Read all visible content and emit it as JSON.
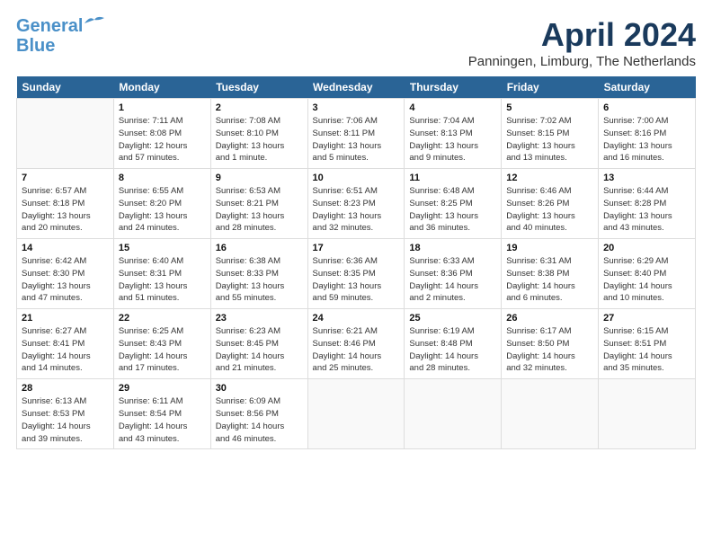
{
  "header": {
    "logo_line1": "General",
    "logo_line2": "Blue",
    "month_title": "April 2024",
    "location": "Panningen, Limburg, The Netherlands"
  },
  "days_of_week": [
    "Sunday",
    "Monday",
    "Tuesday",
    "Wednesday",
    "Thursday",
    "Friday",
    "Saturday"
  ],
  "weeks": [
    [
      {
        "day": "",
        "info": ""
      },
      {
        "day": "1",
        "info": "Sunrise: 7:11 AM\nSunset: 8:08 PM\nDaylight: 12 hours\nand 57 minutes."
      },
      {
        "day": "2",
        "info": "Sunrise: 7:08 AM\nSunset: 8:10 PM\nDaylight: 13 hours\nand 1 minute."
      },
      {
        "day": "3",
        "info": "Sunrise: 7:06 AM\nSunset: 8:11 PM\nDaylight: 13 hours\nand 5 minutes."
      },
      {
        "day": "4",
        "info": "Sunrise: 7:04 AM\nSunset: 8:13 PM\nDaylight: 13 hours\nand 9 minutes."
      },
      {
        "day": "5",
        "info": "Sunrise: 7:02 AM\nSunset: 8:15 PM\nDaylight: 13 hours\nand 13 minutes."
      },
      {
        "day": "6",
        "info": "Sunrise: 7:00 AM\nSunset: 8:16 PM\nDaylight: 13 hours\nand 16 minutes."
      }
    ],
    [
      {
        "day": "7",
        "info": "Sunrise: 6:57 AM\nSunset: 8:18 PM\nDaylight: 13 hours\nand 20 minutes."
      },
      {
        "day": "8",
        "info": "Sunrise: 6:55 AM\nSunset: 8:20 PM\nDaylight: 13 hours\nand 24 minutes."
      },
      {
        "day": "9",
        "info": "Sunrise: 6:53 AM\nSunset: 8:21 PM\nDaylight: 13 hours\nand 28 minutes."
      },
      {
        "day": "10",
        "info": "Sunrise: 6:51 AM\nSunset: 8:23 PM\nDaylight: 13 hours\nand 32 minutes."
      },
      {
        "day": "11",
        "info": "Sunrise: 6:48 AM\nSunset: 8:25 PM\nDaylight: 13 hours\nand 36 minutes."
      },
      {
        "day": "12",
        "info": "Sunrise: 6:46 AM\nSunset: 8:26 PM\nDaylight: 13 hours\nand 40 minutes."
      },
      {
        "day": "13",
        "info": "Sunrise: 6:44 AM\nSunset: 8:28 PM\nDaylight: 13 hours\nand 43 minutes."
      }
    ],
    [
      {
        "day": "14",
        "info": "Sunrise: 6:42 AM\nSunset: 8:30 PM\nDaylight: 13 hours\nand 47 minutes."
      },
      {
        "day": "15",
        "info": "Sunrise: 6:40 AM\nSunset: 8:31 PM\nDaylight: 13 hours\nand 51 minutes."
      },
      {
        "day": "16",
        "info": "Sunrise: 6:38 AM\nSunset: 8:33 PM\nDaylight: 13 hours\nand 55 minutes."
      },
      {
        "day": "17",
        "info": "Sunrise: 6:36 AM\nSunset: 8:35 PM\nDaylight: 13 hours\nand 59 minutes."
      },
      {
        "day": "18",
        "info": "Sunrise: 6:33 AM\nSunset: 8:36 PM\nDaylight: 14 hours\nand 2 minutes."
      },
      {
        "day": "19",
        "info": "Sunrise: 6:31 AM\nSunset: 8:38 PM\nDaylight: 14 hours\nand 6 minutes."
      },
      {
        "day": "20",
        "info": "Sunrise: 6:29 AM\nSunset: 8:40 PM\nDaylight: 14 hours\nand 10 minutes."
      }
    ],
    [
      {
        "day": "21",
        "info": "Sunrise: 6:27 AM\nSunset: 8:41 PM\nDaylight: 14 hours\nand 14 minutes."
      },
      {
        "day": "22",
        "info": "Sunrise: 6:25 AM\nSunset: 8:43 PM\nDaylight: 14 hours\nand 17 minutes."
      },
      {
        "day": "23",
        "info": "Sunrise: 6:23 AM\nSunset: 8:45 PM\nDaylight: 14 hours\nand 21 minutes."
      },
      {
        "day": "24",
        "info": "Sunrise: 6:21 AM\nSunset: 8:46 PM\nDaylight: 14 hours\nand 25 minutes."
      },
      {
        "day": "25",
        "info": "Sunrise: 6:19 AM\nSunset: 8:48 PM\nDaylight: 14 hours\nand 28 minutes."
      },
      {
        "day": "26",
        "info": "Sunrise: 6:17 AM\nSunset: 8:50 PM\nDaylight: 14 hours\nand 32 minutes."
      },
      {
        "day": "27",
        "info": "Sunrise: 6:15 AM\nSunset: 8:51 PM\nDaylight: 14 hours\nand 35 minutes."
      }
    ],
    [
      {
        "day": "28",
        "info": "Sunrise: 6:13 AM\nSunset: 8:53 PM\nDaylight: 14 hours\nand 39 minutes."
      },
      {
        "day": "29",
        "info": "Sunrise: 6:11 AM\nSunset: 8:54 PM\nDaylight: 14 hours\nand 43 minutes."
      },
      {
        "day": "30",
        "info": "Sunrise: 6:09 AM\nSunset: 8:56 PM\nDaylight: 14 hours\nand 46 minutes."
      },
      {
        "day": "",
        "info": ""
      },
      {
        "day": "",
        "info": ""
      },
      {
        "day": "",
        "info": ""
      },
      {
        "day": "",
        "info": ""
      }
    ]
  ]
}
